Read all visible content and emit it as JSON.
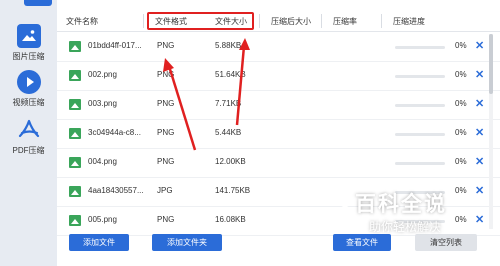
{
  "sidebar": {
    "items": [
      {
        "label": "图片压缩",
        "icon": "image-icon"
      },
      {
        "label": "视频压缩",
        "icon": "play-icon"
      },
      {
        "label": "PDF压缩",
        "icon": "pdf-icon"
      }
    ]
  },
  "table": {
    "headers": [
      "文件名称",
      "文件格式",
      "文件大小",
      "压缩后大小",
      "压缩率",
      "压缩进度"
    ],
    "rows": [
      {
        "name": "01bdd4ff-017...",
        "format": "PNG",
        "size": "5.88KB",
        "progress": "0%"
      },
      {
        "name": "002.png",
        "format": "PNG",
        "size": "51.64KB",
        "progress": "0%"
      },
      {
        "name": "003.png",
        "format": "PNG",
        "size": "7.71KB",
        "progress": "0%"
      },
      {
        "name": "3c04944a-c8...",
        "format": "PNG",
        "size": "5.44KB",
        "progress": "0%"
      },
      {
        "name": "004.png",
        "format": "PNG",
        "size": "12.00KB",
        "progress": "0%"
      },
      {
        "name": "4aa18430557...",
        "format": "JPG",
        "size": "141.75KB",
        "progress": "0%"
      },
      {
        "name": "005.png",
        "format": "PNG",
        "size": "16.08KB",
        "progress": "0%"
      }
    ],
    "progress_values": [
      0,
      0,
      0,
      0,
      0,
      0,
      0
    ],
    "delete_glyph": "✕"
  },
  "buttons": {
    "add_file": "添加文件",
    "add_folder": "添加文件夹",
    "view_file": "查看文件",
    "clear_list": "清空列表"
  },
  "watermark": {
    "title": "百科全说",
    "subtitle": "助你轻松解决"
  },
  "colors": {
    "accent": "#2b6cd8",
    "annotation": "#e02020",
    "thumb": "#3aa55a"
  }
}
